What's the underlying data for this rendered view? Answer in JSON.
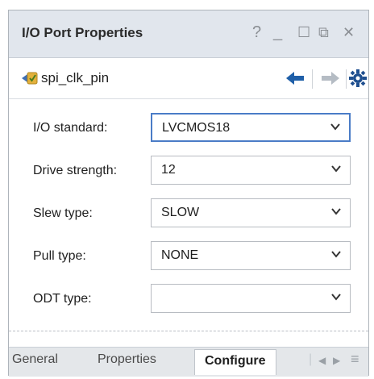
{
  "window": {
    "title": "I/O Port Properties",
    "controls": {
      "help": "?",
      "minimize": "_",
      "maximize": "☐",
      "restore": "⧉",
      "close": "✕"
    }
  },
  "object": {
    "name": "spi_clk_pin",
    "icon": "port-icon",
    "nav": {
      "back": "🡄",
      "forward": "🡆",
      "settings": "⚙"
    }
  },
  "fields": {
    "io_standard": {
      "label": "I/O standard:",
      "value": "LVCMOS18"
    },
    "drive_strength": {
      "label": "Drive strength:",
      "value": "12"
    },
    "slew_type": {
      "label": "Slew type:",
      "value": "SLOW"
    },
    "pull_type": {
      "label": "Pull type:",
      "value": "NONE"
    },
    "odt_type": {
      "label": "ODT type:",
      "value": ""
    }
  },
  "tabs": {
    "general": "General",
    "properties": "Properties",
    "configure": "Configure",
    "prev": "◀",
    "next": "▶",
    "menu": "≡"
  },
  "colors": {
    "accent": "#4a7cc7",
    "titlebar": "#e1e6ed",
    "nav_active": "#1f5fa8",
    "nav_disabled": "#b5bcc4"
  }
}
